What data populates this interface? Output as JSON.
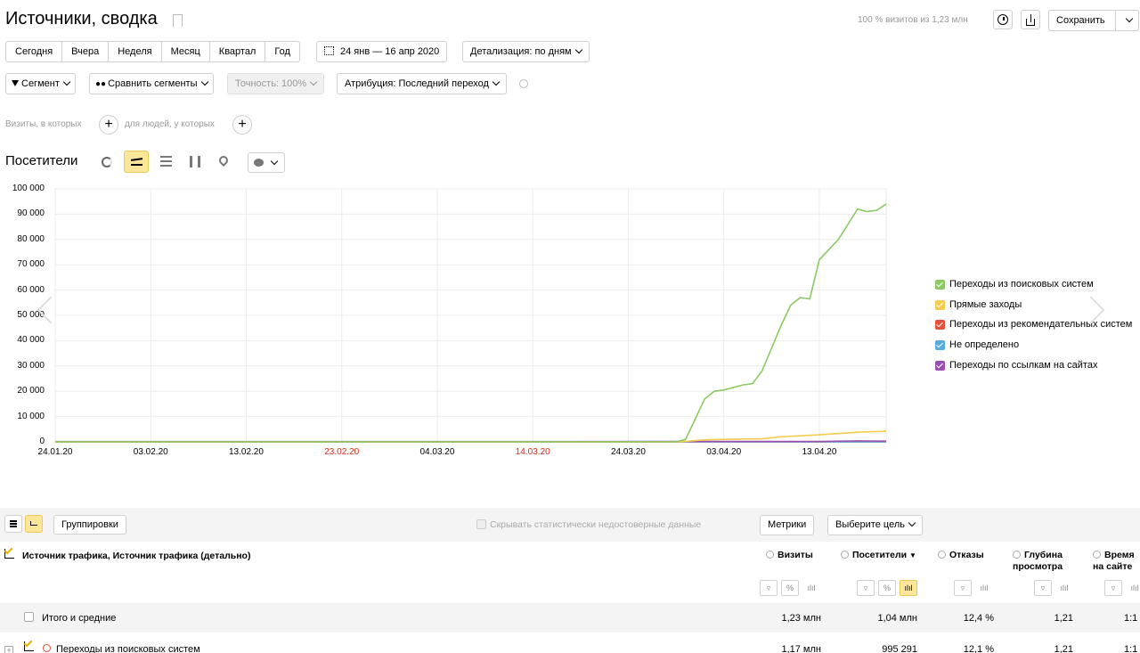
{
  "header": {
    "title": "Источники, сводка",
    "visits_summary": "100 % визитов из 1,23 млн",
    "save_label": "Сохранить"
  },
  "periods": [
    "Сегодня",
    "Вчера",
    "Неделя",
    "Месяц",
    "Квартал",
    "Год"
  ],
  "date_range": "24 янв — 16 апр 2020",
  "detail_label": "Детализация: по дням",
  "filters": {
    "segment": "Сегмент",
    "compare": "Сравнить сегменты",
    "accuracy": "Точность: 100%",
    "attribution": "Атрибуция: Последний переход"
  },
  "conditions": {
    "visits_label": "Визиты, в которых",
    "people_label": "для людей, у которых"
  },
  "chart_section": {
    "title": "Посетители"
  },
  "chart_data": {
    "type": "line",
    "x": [
      "24.01.20",
      "03.02.20",
      "13.02.20",
      "23.02.20",
      "04.03.20",
      "14.03.20",
      "24.03.20",
      "03.04.20",
      "13.04.20"
    ],
    "x_labels_red": [
      "23.02.20",
      "14.03.20"
    ],
    "yticks": [
      "100 000",
      "90 000",
      "80 000",
      "70 000",
      "60 000",
      "50 000",
      "40 000",
      "30 000",
      "20 000",
      "10 000",
      "0"
    ],
    "ylim": [
      0,
      100000
    ],
    "series": [
      {
        "name": "Переходы из поисковых систем",
        "color": "#8ac964",
        "points": [
          [
            0,
            0
          ],
          [
            65,
            0
          ],
          [
            66,
            1000
          ],
          [
            68,
            17000
          ],
          [
            69,
            20000
          ],
          [
            70,
            20500
          ],
          [
            71,
            21500
          ],
          [
            72,
            22500
          ],
          [
            73,
            23000
          ],
          [
            74,
            28000
          ],
          [
            75,
            37000
          ],
          [
            76,
            46000
          ],
          [
            77,
            54000
          ],
          [
            78,
            57000
          ],
          [
            79,
            56500
          ],
          [
            80,
            72000
          ],
          [
            81,
            76000
          ],
          [
            82,
            80000
          ],
          [
            83,
            86000
          ],
          [
            84,
            92000
          ],
          [
            85,
            91000
          ],
          [
            86,
            91500
          ],
          [
            87,
            94000
          ]
        ]
      },
      {
        "name": "Прямые заходы",
        "color": "#f5cc4e",
        "points": [
          [
            0,
            0
          ],
          [
            65,
            0
          ],
          [
            66,
            200
          ],
          [
            68,
            800
          ],
          [
            70,
            1000
          ],
          [
            74,
            1200
          ],
          [
            76,
            2000
          ],
          [
            80,
            2800
          ],
          [
            84,
            3800
          ],
          [
            87,
            4200
          ]
        ]
      },
      {
        "name": "Переходы из рекомендательных систем",
        "color": "#e8503a",
        "points": [
          [
            0,
            0
          ],
          [
            87,
            0
          ]
        ]
      },
      {
        "name": "Не определено",
        "color": "#58abe0",
        "points": [
          [
            0,
            0
          ],
          [
            87,
            0
          ]
        ]
      },
      {
        "name": "Переходы по ссылкам на сайтах",
        "color": "#9b4fb1",
        "points": [
          [
            0,
            100
          ],
          [
            80,
            150
          ],
          [
            84,
            400
          ],
          [
            87,
            300
          ]
        ]
      }
    ]
  },
  "table_toolbar": {
    "groupings_label": "Группировки",
    "hide_unreliable_label": "Скрывать статистически недостоверные данные",
    "metrics_label": "Метрики",
    "goal_label": "Выберите цель"
  },
  "table": {
    "dimension_header": "Источник трафика, Источник трафика (детально)",
    "columns": [
      "Визиты",
      "Посетители",
      "Отказы",
      "Глубина просмотра",
      "Время на сайте"
    ],
    "totals": {
      "label": "Итого и средние",
      "values": [
        "1,23 млн",
        "1,04 млн",
        "12,4 %",
        "1,21",
        "1:1"
      ]
    },
    "rows": [
      {
        "label": "Переходы из поисковых систем",
        "values": [
          "1,17 млн",
          "995 291",
          "12,1 %",
          "1,21",
          "1:1"
        ]
      }
    ]
  }
}
